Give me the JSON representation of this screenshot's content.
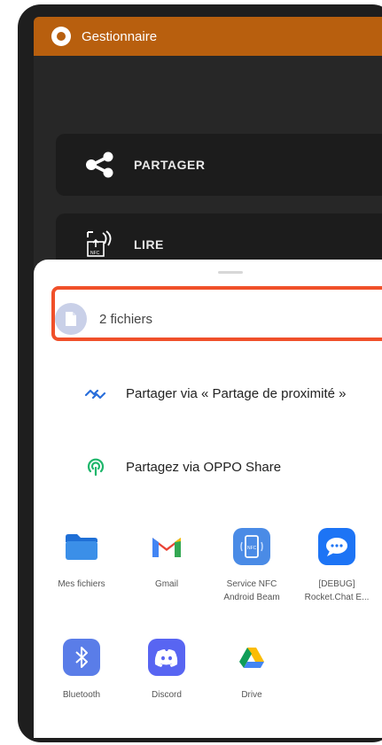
{
  "app": {
    "title": "Gestionnaire"
  },
  "actions": [
    {
      "label": "PARTAGER",
      "icon": "share-icon"
    },
    {
      "label": "LIRE",
      "icon": "nfc-read-icon"
    }
  ],
  "sheet": {
    "files_label": "2 fichiers",
    "quick_shares": [
      {
        "label": "Partager via « Partage de proximité »",
        "icon": "nearby-share-icon"
      },
      {
        "label": "Partagez via OPPO Share",
        "icon": "oppo-share-icon"
      }
    ],
    "apps": [
      {
        "name": "Mes fichiers",
        "icon": "folder-icon"
      },
      {
        "name": "Gmail",
        "icon": "gmail-icon"
      },
      {
        "name": "Service NFC\nAndroid Beam",
        "icon": "nfc-service-icon"
      },
      {
        "name": "[DEBUG]\nRocket.Chat E...",
        "icon": "rocket-chat-icon"
      },
      {
        "name": "Bluetooth",
        "icon": "bluetooth-icon"
      },
      {
        "name": "Discord",
        "icon": "discord-icon"
      },
      {
        "name": "Drive",
        "icon": "drive-icon"
      }
    ]
  },
  "colors": {
    "appbar": "#b85f0e",
    "highlight": "#f0502a",
    "folder": "#3b8fe8",
    "bluetooth": "#5a7de8",
    "discord": "#5865f2"
  }
}
